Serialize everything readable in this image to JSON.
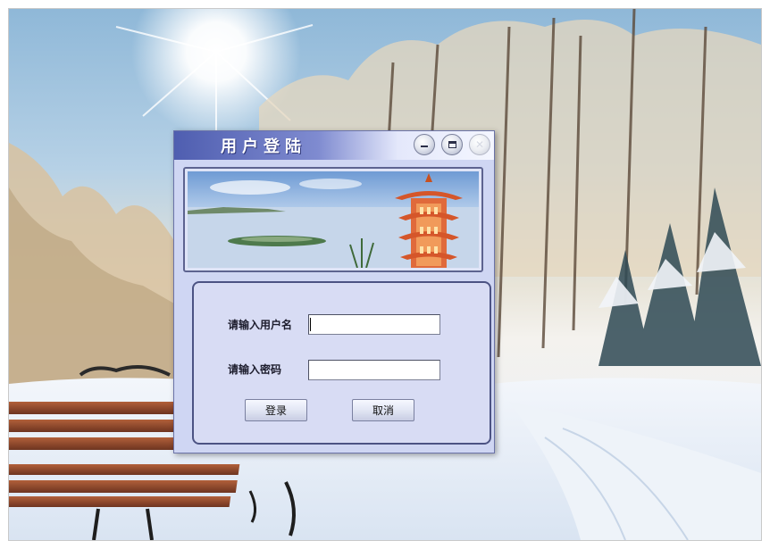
{
  "window": {
    "title": "用户登陆",
    "title_bar_colors": {
      "start": "#4f5eb0",
      "end": "#f4f6ff"
    }
  },
  "window_controls": {
    "minimize_icon": "minimize-icon",
    "maximize_icon": "maximize-icon",
    "close_icon": "close-icon"
  },
  "banner": {
    "icon": "pagoda-lake-landscape"
  },
  "form": {
    "username_label": "请输入用户名",
    "username_value": "",
    "password_label": "请输入密码",
    "password_value": "",
    "login_button": "登录",
    "cancel_button": "取消"
  },
  "desktop": {
    "wallpaper": "snowy-forest-park-with-bench"
  }
}
